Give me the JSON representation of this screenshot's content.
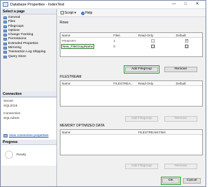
{
  "window": {
    "title": "Database Properties - IndexTest",
    "minimize_glyph": "—",
    "maximize_glyph": "□",
    "close_glyph": "✕"
  },
  "sidebar": {
    "select_page_heading": "Select a page",
    "items": [
      {
        "label": "General"
      },
      {
        "label": "Files"
      },
      {
        "label": "Filegroups"
      },
      {
        "label": "Options"
      },
      {
        "label": "Change Tracking"
      },
      {
        "label": "Permissions"
      },
      {
        "label": "Extended Properties"
      },
      {
        "label": "Mirroring"
      },
      {
        "label": "Transaction Log Shipping"
      },
      {
        "label": "Query Store"
      }
    ],
    "connection_heading": "Connection",
    "server_label": "Server:",
    "server_value": "SQL2016",
    "connection_label": "Connection:",
    "connection_value": "SQLAdmin",
    "view_link": "View connection properties",
    "progress_heading": "Progress",
    "progress_status": "Ready"
  },
  "toolbar": {
    "script_label": "Script",
    "help_label": "Help",
    "dropdown_glyph": "▾"
  },
  "rows_section": {
    "title": "Rows",
    "columns": [
      "Name",
      "Files",
      "Read-Only",
      "Default"
    ],
    "rows": [
      {
        "name": "PRIMARY",
        "files": "1",
        "read_only": false,
        "default": true
      },
      {
        "name": "New_FileGroupName",
        "files": "0",
        "read_only": false,
        "default": false
      }
    ],
    "add_button": "Add Filegroup",
    "remove_button": "Remove"
  },
  "filestream_section": {
    "title": "FILESTREAM",
    "columns": [
      "Name",
      "FILESTREA...",
      "Read-Only",
      "Default"
    ],
    "add_button": "Add Filegroup",
    "remove_button": "Remove"
  },
  "memory_section": {
    "title": "MEMORY OPTIMIZED DATA",
    "columns": [
      "Name",
      "FILESTREAM Files"
    ],
    "add_button": "Add Filegroup",
    "remove_button": "Remove"
  },
  "footer": {
    "ok_button": "OK",
    "cancel_button": "Cancel"
  },
  "colors": {
    "highlight": "#24a324",
    "link": "#0645ad"
  }
}
